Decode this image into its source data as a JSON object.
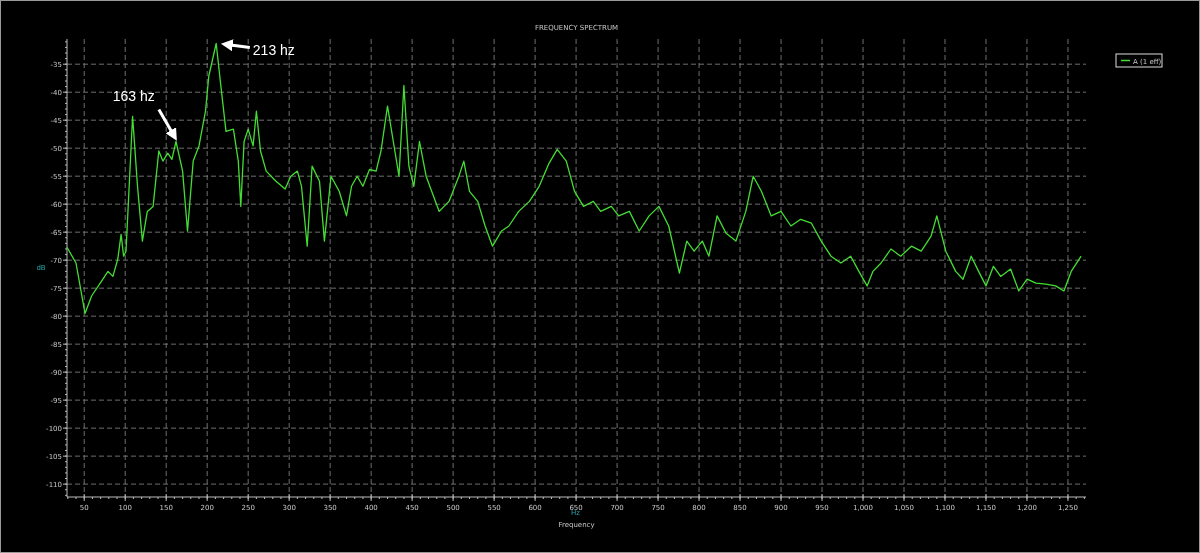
{
  "chart": {
    "unit_label": "Hz",
    "chart_data": {
      "type": "line",
      "title": "FREQUENCY SPECTRUM",
      "xlabel": "Frequency",
      "ylabel": "dB",
      "x": [
        29,
        40,
        51,
        59,
        71,
        79,
        85,
        91,
        95,
        98,
        101,
        109,
        115,
        121,
        127,
        134,
        141,
        146,
        152,
        157,
        162,
        170,
        176,
        183,
        190,
        198,
        202,
        211,
        216,
        223,
        232,
        238,
        241,
        245,
        250,
        256,
        260,
        265,
        272,
        284,
        295,
        302,
        310,
        315,
        322,
        328,
        337,
        343,
        351,
        361,
        370,
        376,
        383,
        390,
        398,
        406,
        412,
        420,
        427,
        434,
        440,
        446,
        452,
        459,
        467,
        483,
        495,
        507,
        513,
        520,
        530,
        539,
        548,
        559,
        568,
        580,
        593,
        605,
        617,
        627,
        638,
        648,
        659,
        671,
        680,
        693,
        702,
        715,
        727,
        739,
        751,
        763,
        776,
        785,
        794,
        804,
        812,
        822,
        833,
        845,
        857,
        866,
        876,
        888,
        900,
        912,
        924,
        937,
        949,
        961,
        973,
        985,
        995,
        1005,
        1012,
        1022,
        1034,
        1046,
        1059,
        1071,
        1083,
        1090,
        1101,
        1113,
        1122,
        1132,
        1141,
        1150,
        1159,
        1168,
        1180,
        1190,
        1200,
        1211,
        1223,
        1235,
        1245,
        1254,
        1266
      ],
      "series": [
        {
          "name": "A (1 eff)",
          "color": "#44dd33",
          "values": [
            -67.7,
            -70.5,
            -79.5,
            -76.4,
            -73.8,
            -72.0,
            -72.9,
            -69.8,
            -65.4,
            -69.3,
            -68.4,
            -44.3,
            -56.8,
            -66.6,
            -61.3,
            -60.4,
            -50.5,
            -52.3,
            -50.9,
            -52.0,
            -48.8,
            -54.1,
            -64.8,
            -52.3,
            -49.6,
            -43.4,
            -37.1,
            -31.3,
            -38.0,
            -47.0,
            -46.6,
            -52.3,
            -60.4,
            -48.8,
            -46.6,
            -49.6,
            -43.4,
            -50.5,
            -54.1,
            -55.9,
            -57.3,
            -55.0,
            -54.1,
            -56.8,
            -67.5,
            -53.2,
            -55.9,
            -66.6,
            -55.0,
            -57.7,
            -62.1,
            -56.8,
            -55.0,
            -56.8,
            -53.8,
            -54.1,
            -50.5,
            -42.5,
            -48.8,
            -55.0,
            -38.8,
            -53.2,
            -56.8,
            -48.8,
            -55.0,
            -61.3,
            -59.5,
            -55.0,
            -52.3,
            -57.7,
            -59.5,
            -63.9,
            -67.5,
            -64.8,
            -63.9,
            -61.3,
            -59.5,
            -56.8,
            -52.7,
            -50.2,
            -52.3,
            -57.7,
            -60.4,
            -59.5,
            -61.3,
            -60.4,
            -62.1,
            -61.3,
            -64.8,
            -62.1,
            -60.4,
            -63.9,
            -72.3,
            -66.6,
            -68.4,
            -66.6,
            -69.3,
            -62.1,
            -65.2,
            -66.6,
            -61.3,
            -55.0,
            -57.7,
            -62.1,
            -61.3,
            -63.9,
            -62.7,
            -63.4,
            -66.6,
            -69.3,
            -70.5,
            -69.3,
            -72.0,
            -74.6,
            -72.0,
            -70.5,
            -68.0,
            -69.3,
            -67.5,
            -68.4,
            -65.7,
            -62.1,
            -68.4,
            -72.0,
            -73.4,
            -69.3,
            -72.0,
            -74.6,
            -71.1,
            -72.9,
            -71.6,
            -75.5,
            -73.4,
            -74.1,
            -74.3,
            -74.6,
            -75.5,
            -72.0,
            -69.3
          ]
        }
      ],
      "xlim": [
        29,
        1272
      ],
      "grid": true,
      "ylim": [
        -112.3,
        -30.5
      ],
      "xticks": [
        50,
        100,
        150,
        200,
        250,
        300,
        350,
        400,
        450,
        500,
        550,
        600,
        650,
        700,
        750,
        800,
        850,
        900,
        950,
        {
          "value": 1000,
          "label": "1,000"
        },
        {
          "value": 1050,
          "label": "1,050"
        },
        {
          "value": 1100,
          "label": "1,100"
        },
        {
          "value": 1150,
          "label": "1,150"
        },
        {
          "value": 1200,
          "label": "1,200"
        },
        {
          "value": 1250,
          "label": "1,250"
        }
      ],
      "yticks": [
        -35,
        -40,
        -45,
        -50,
        -55,
        -60,
        -65,
        -70,
        -75,
        -80,
        -85,
        -90,
        -95,
        -100,
        -105,
        -110
      ],
      "annotations": [
        {
          "text": "213 hz",
          "x": 213,
          "y": -31.3
        },
        {
          "text": "163 hz",
          "x": 163,
          "y": -48.8
        }
      ]
    }
  }
}
